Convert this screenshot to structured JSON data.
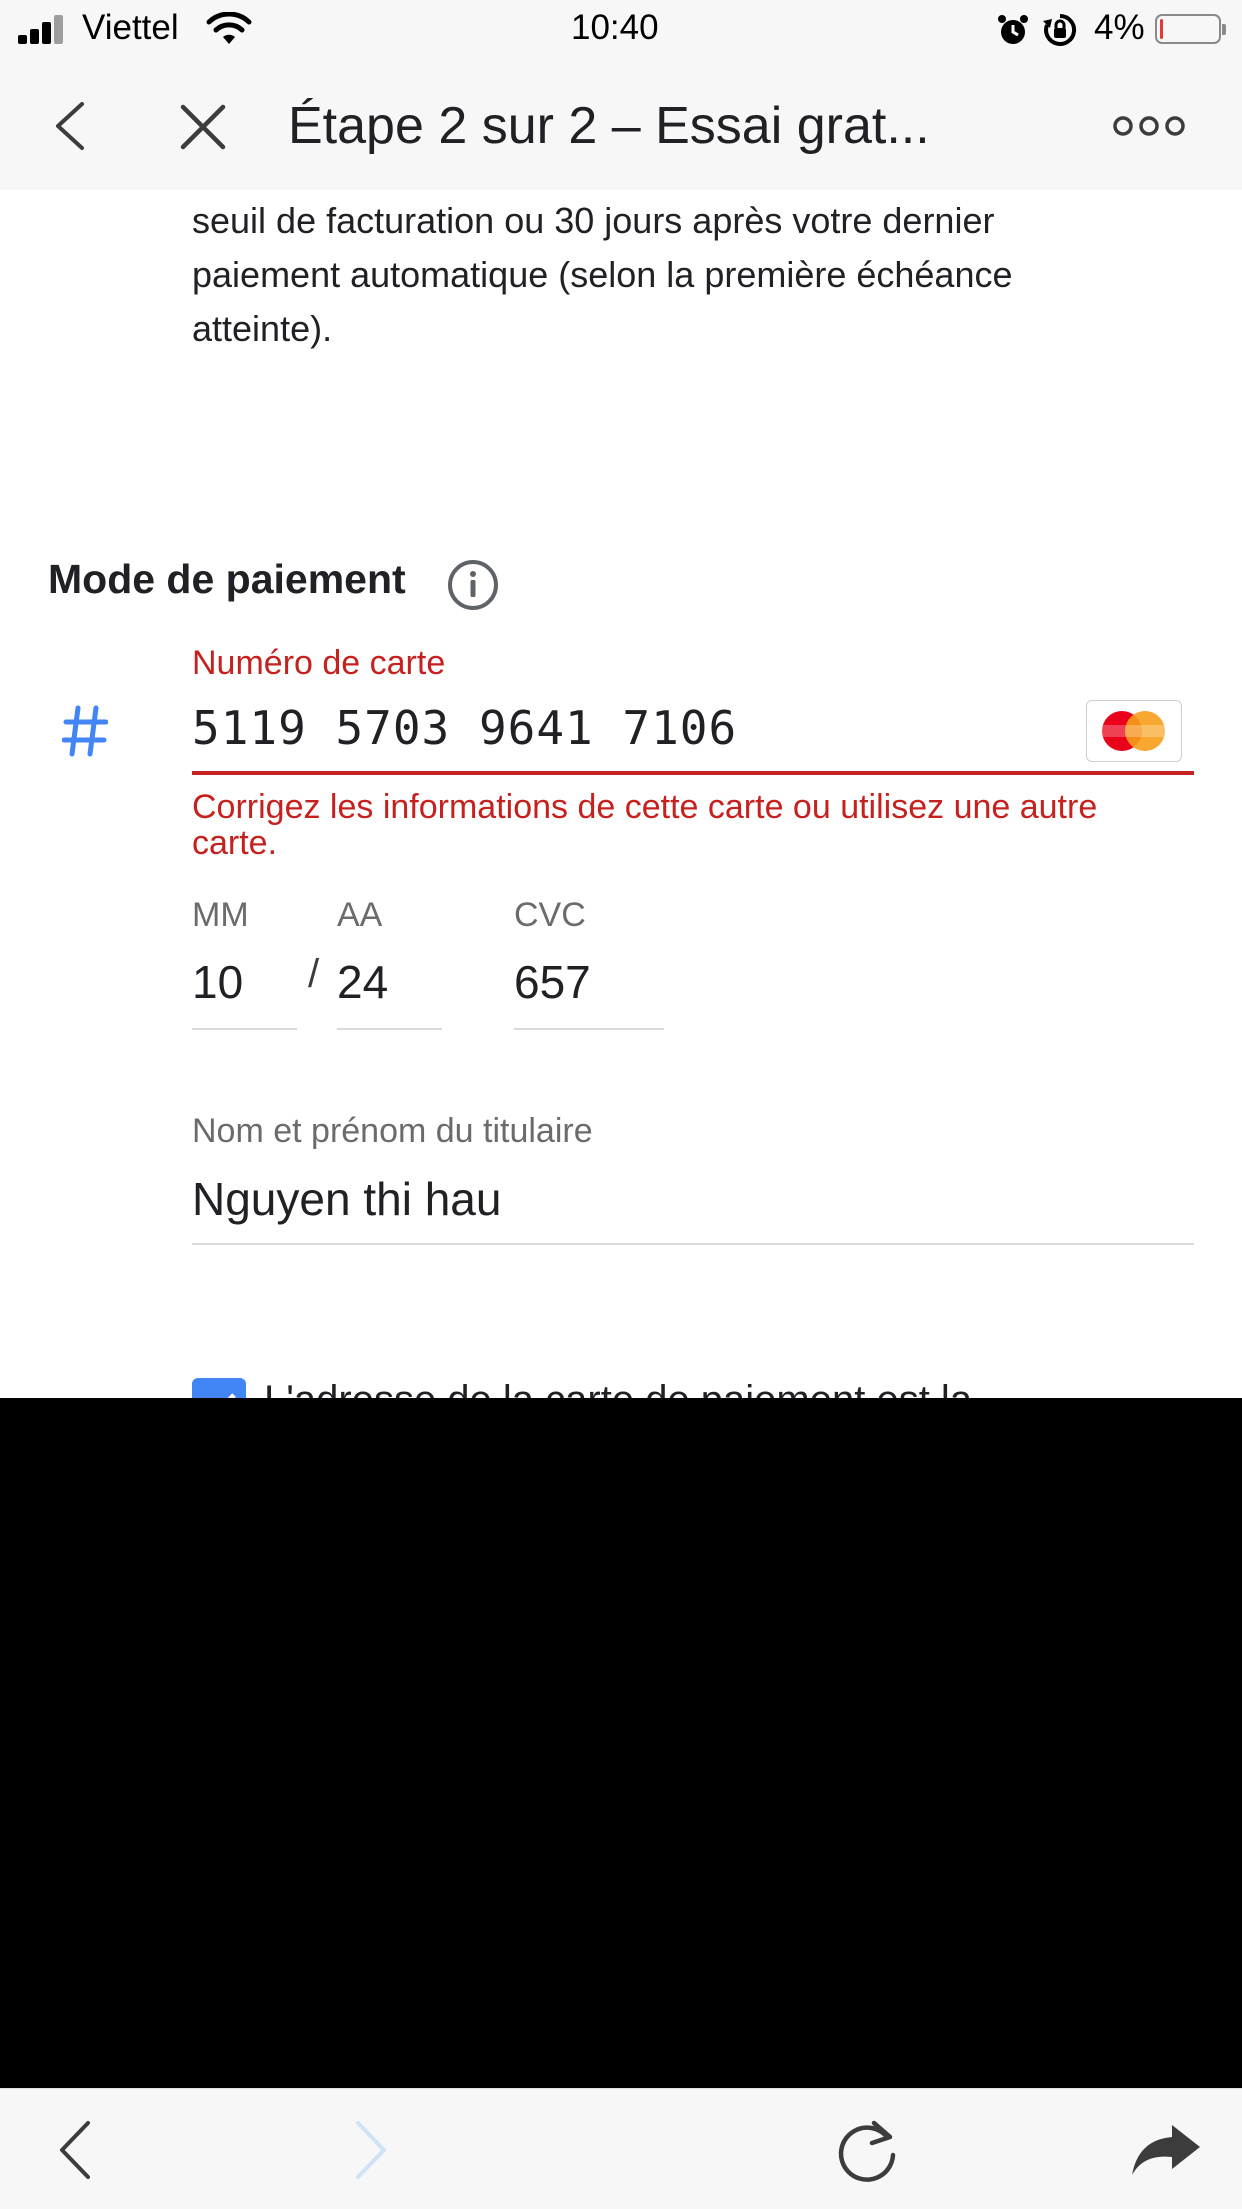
{
  "status_bar": {
    "carrier": "Viettel",
    "time": "10:40",
    "battery_percent": "4%",
    "battery_level": 0.04
  },
  "app_bar": {
    "title": "Étape 2 sur 2 – Essai grat..."
  },
  "intro": {
    "line1": "seuil de facturation ou 30 jours après votre dernier",
    "line2": "paiement automatique (selon la première échéance",
    "line3": "atteinte)."
  },
  "payment": {
    "section_title": "Mode de paiement",
    "card_number_label": "Numéro de carte",
    "card_number": "5119 5703 9641 7106",
    "card_brand": "MasterCard",
    "error_line1": "Corrigez les informations de cette carte ou utilisez une autre",
    "error_line2": "carte.",
    "month_label": "MM",
    "month": "10",
    "separator": "/",
    "year_label": "AA",
    "year": "24",
    "cvc_label": "CVC",
    "cvc": "657",
    "holder_label": "Nom et prénom du titulaire",
    "holder": "Nguyen thi hau",
    "checkbox_partial": "L'adresse de la carte de paiement est la",
    "checkbox_checked": true
  },
  "colors": {
    "error": "#c5221f",
    "accent": "#4285f4",
    "bars": "#f7f7f7"
  }
}
